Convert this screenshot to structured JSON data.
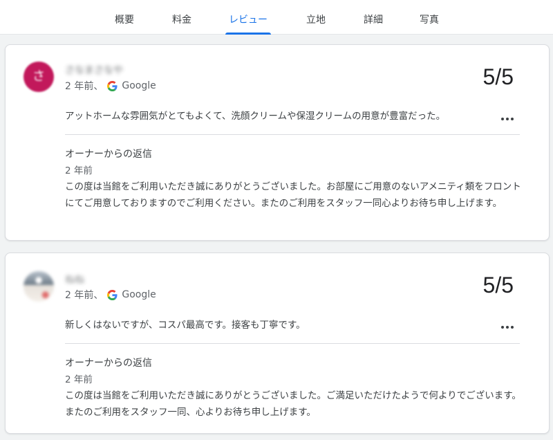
{
  "tabs": [
    {
      "label": "概要",
      "active": false
    },
    {
      "label": "料金",
      "active": false
    },
    {
      "label": "レビュー",
      "active": true
    },
    {
      "label": "立地",
      "active": false
    },
    {
      "label": "詳細",
      "active": false
    },
    {
      "label": "写真",
      "active": false
    }
  ],
  "reviews": [
    {
      "reviewer_name": "さなまさなや",
      "avatar_initial": "さ",
      "avatar_color": "#c2185b",
      "time_ago": "2 年前、",
      "source": "Google",
      "rating": "5/5",
      "text": "アットホームな雰囲気がとてもよくて、洗顔クリームや保湿クリームの用意が豊富だった。",
      "owner_reply": {
        "title": "オーナーからの返信",
        "time_ago": "2 年前",
        "text": "この度は当館をご利用いただき誠にありがとうございました。お部屋にご用意のないアメニティ類をフロントにてご用意しておりますのでご利用ください。またのご利用をスタッフ一同心よりお待ち申し上げます。"
      }
    },
    {
      "reviewer_name": "ねね",
      "avatar_initial": "",
      "avatar_color": "#8a96a3",
      "time_ago": "2 年前、",
      "source": "Google",
      "rating": "5/5",
      "text": "新しくはないですが、コスパ最高です。接客も丁寧です。",
      "owner_reply": {
        "title": "オーナーからの返信",
        "time_ago": "2 年前",
        "text": "この度は当館をご利用いただき誠にありがとうございました。ご満足いただけたようで何よりでございます。またのご利用をスタッフ一同、心よりお待ち申し上げます。"
      }
    }
  ],
  "icons": {
    "google": "google-g-icon",
    "more": "more-horizontal-icon"
  },
  "colors": {
    "accent": "#1a73e8",
    "text": "#202124",
    "muted": "#5f6368",
    "divider": "#dadce0"
  }
}
